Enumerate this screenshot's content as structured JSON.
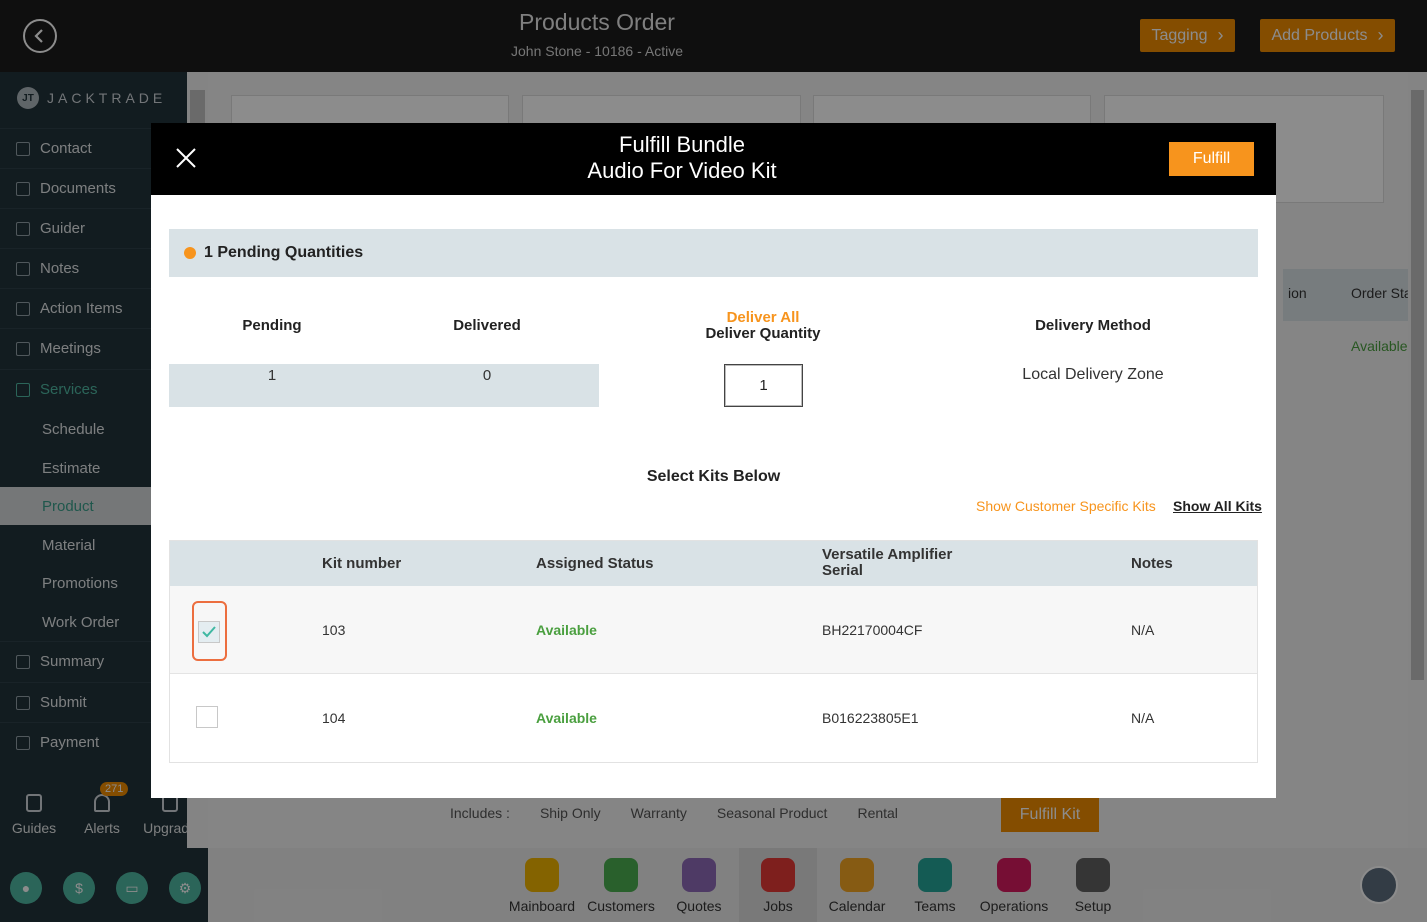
{
  "topbar": {
    "title": "Products Order",
    "subtitle": "John Stone - 10186 - Active",
    "tagging_label": "Tagging",
    "add_products_label": "Add Products"
  },
  "sidebar": {
    "brand": "JACKTRADE",
    "brand_mark": "JT",
    "items": [
      {
        "label": "Contact"
      },
      {
        "label": "Documents"
      },
      {
        "label": "Guider"
      },
      {
        "label": "Notes"
      },
      {
        "label": "Action Items"
      },
      {
        "label": "Meetings"
      },
      {
        "label": "Services"
      },
      {
        "label": "Schedule"
      },
      {
        "label": "Estimate"
      },
      {
        "label": "Product"
      },
      {
        "label": "Material"
      },
      {
        "label": "Promotions"
      },
      {
        "label": "Work Order"
      },
      {
        "label": "Summary"
      },
      {
        "label": "Submit"
      },
      {
        "label": "Payment"
      }
    ],
    "tools": [
      {
        "label": "Guides"
      },
      {
        "label": "Alerts",
        "badge": "271"
      },
      {
        "label": "Upgrade"
      }
    ]
  },
  "background": {
    "table_header_partial": "ion",
    "order_status_partial": "Order Sta",
    "status_available": "Available"
  },
  "footer": {
    "includes_label": "Includes :",
    "tags": [
      "Ship Only",
      "Warranty",
      "Seasonal Product",
      "Rental"
    ],
    "fulfill_kit_label": "Fulfill Kit"
  },
  "dock": {
    "items": [
      {
        "label": "Mainboard",
        "color": "#f0b400"
      },
      {
        "label": "Customers",
        "color": "#4caf50"
      },
      {
        "label": "Quotes",
        "color": "#8e6bb8"
      },
      {
        "label": "Jobs",
        "color": "#e53935"
      },
      {
        "label": "Calendar",
        "color": "#f5a623"
      },
      {
        "label": "Teams",
        "color": "#26a69a"
      },
      {
        "label": "Operations",
        "color": "#d81b60"
      },
      {
        "label": "Setup",
        "color": "#616161"
      }
    ]
  },
  "modal": {
    "title_line1": "Fulfill Bundle",
    "title_line2": "Audio For Video Kit",
    "fulfill_label": "Fulfill",
    "pending_text": "1 Pending Quantities",
    "columns": {
      "pending": "Pending",
      "delivered": "Delivered",
      "deliver_all": "Deliver All",
      "deliver_quantity": "Deliver Quantity",
      "delivery_method": "Delivery Method"
    },
    "values": {
      "pending": "1",
      "delivered": "0",
      "deliver_quantity": "1",
      "delivery_method": "Local Delivery Zone"
    },
    "select_kits_label": "Select Kits Below",
    "show_customer_kits": "Show Customer Specific Kits",
    "show_all_kits": "Show All Kits",
    "kit_table": {
      "headers": [
        "Kit number",
        "Assigned Status",
        "Versatile Amplifier Serial",
        "Notes"
      ],
      "header_serial_line1": "Versatile Amplifier",
      "header_serial_line2": "Serial",
      "rows": [
        {
          "kit": "103",
          "status": "Available",
          "serial": "BH22170004CF",
          "notes": "N/A",
          "checked": true
        },
        {
          "kit": "104",
          "status": "Available",
          "serial": "B016223805E1",
          "notes": "N/A",
          "checked": false
        }
      ]
    }
  },
  "colors": {
    "accent_orange": "#f7941d",
    "sidebar_bg": "#22333b",
    "teal": "#4fb8a2",
    "available_green": "#4a9f3f"
  }
}
